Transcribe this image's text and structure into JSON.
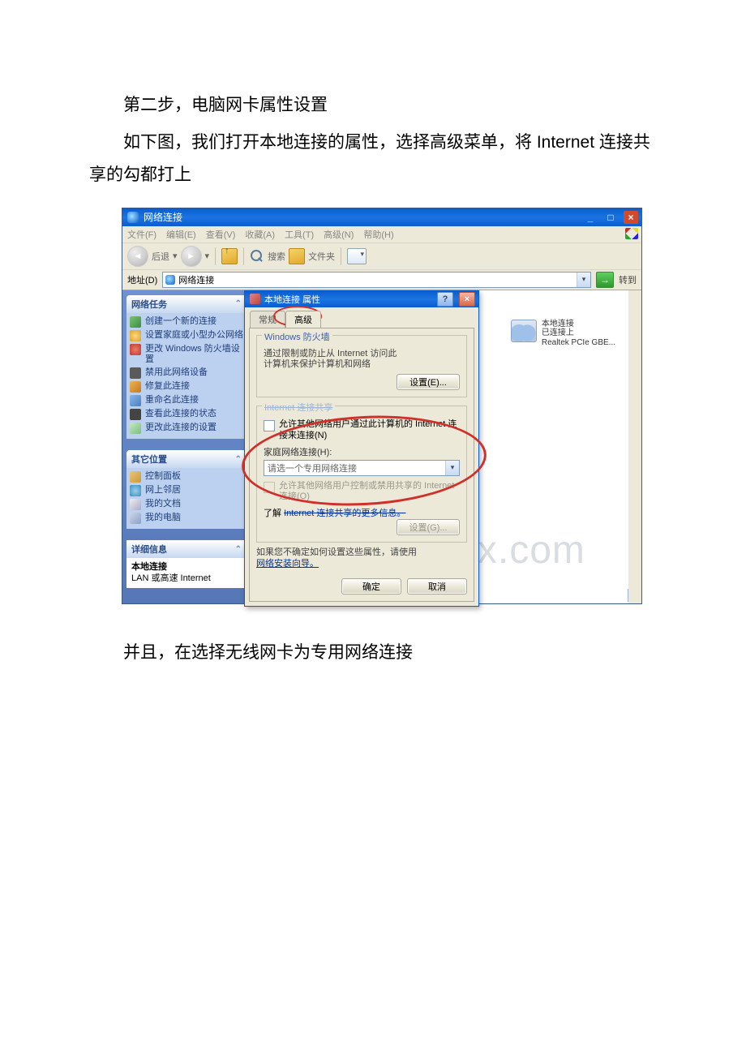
{
  "doc": {
    "para1": "第二步，电脑网卡属性设置",
    "para2": "如下图，我们打开本地连接的属性，选择高级菜单，将 Internet 连接共享的勾都打上",
    "para3": "并且，在选择无线网卡为专用网络连接"
  },
  "explorer": {
    "title": "网络连接",
    "menus": [
      "文件(F)",
      "编辑(E)",
      "查看(V)",
      "收藏(A)",
      "工具(T)",
      "高级(N)",
      "帮助(H)"
    ],
    "toolbar": {
      "back": "后退",
      "search": "搜索",
      "folders": "文件夹"
    },
    "address_label": "地址(D)",
    "address_value": "网络连接",
    "go_label": "转到"
  },
  "side": {
    "tasks_title": "网络任务",
    "tasks": [
      "创建一个新的连接",
      "设置家庭或小型办公网络",
      "更改 Windows 防火墙设置",
      "禁用此网络设备",
      "修复此连接",
      "重命名此连接",
      "查看此连接的状态",
      "更改此连接的设置"
    ],
    "other_title": "其它位置",
    "other": [
      "控制面板",
      "网上邻居",
      "我的文档",
      "我的电脑"
    ],
    "details_title": "详细信息",
    "details": {
      "name": "本地连接",
      "type": "LAN 或高速 Internet"
    }
  },
  "content": {
    "conn": {
      "name": "本地连接",
      "status": "已连接上",
      "device": "Realtek PCIe GBE..."
    }
  },
  "dialog": {
    "title": "本地连接 属性",
    "help": "?",
    "tabs": {
      "general": "常规",
      "advanced": "高级"
    },
    "firewall": {
      "group": "Windows 防火墙",
      "desc": "通过限制或防止从 Internet 访问此计算机来保护计算机和网络",
      "btn": "设置(E)..."
    },
    "sharing": {
      "group": "Internet 连接共享",
      "allow_connect": "允许其他网络用户通过此计算机的 Internet 连接来连接(N)",
      "home_label": "家庭网络连接(H):",
      "home_placeholder": "请选一个专用网络连接",
      "allow_control": "允许其他网络用户控制或禁用共享的 Internet 连接(O)",
      "learn_prefix": "了解",
      "learn_link": "Internet 连接共享的更多信息。",
      "settings_btn": "设置(G)..."
    },
    "wizard": {
      "hint": "如果您不确定如何设置这些属性，请使用",
      "link": "网络安装向导。"
    },
    "ok": "确定",
    "cancel": "取消"
  },
  "watermark": "www.bdocx.com"
}
